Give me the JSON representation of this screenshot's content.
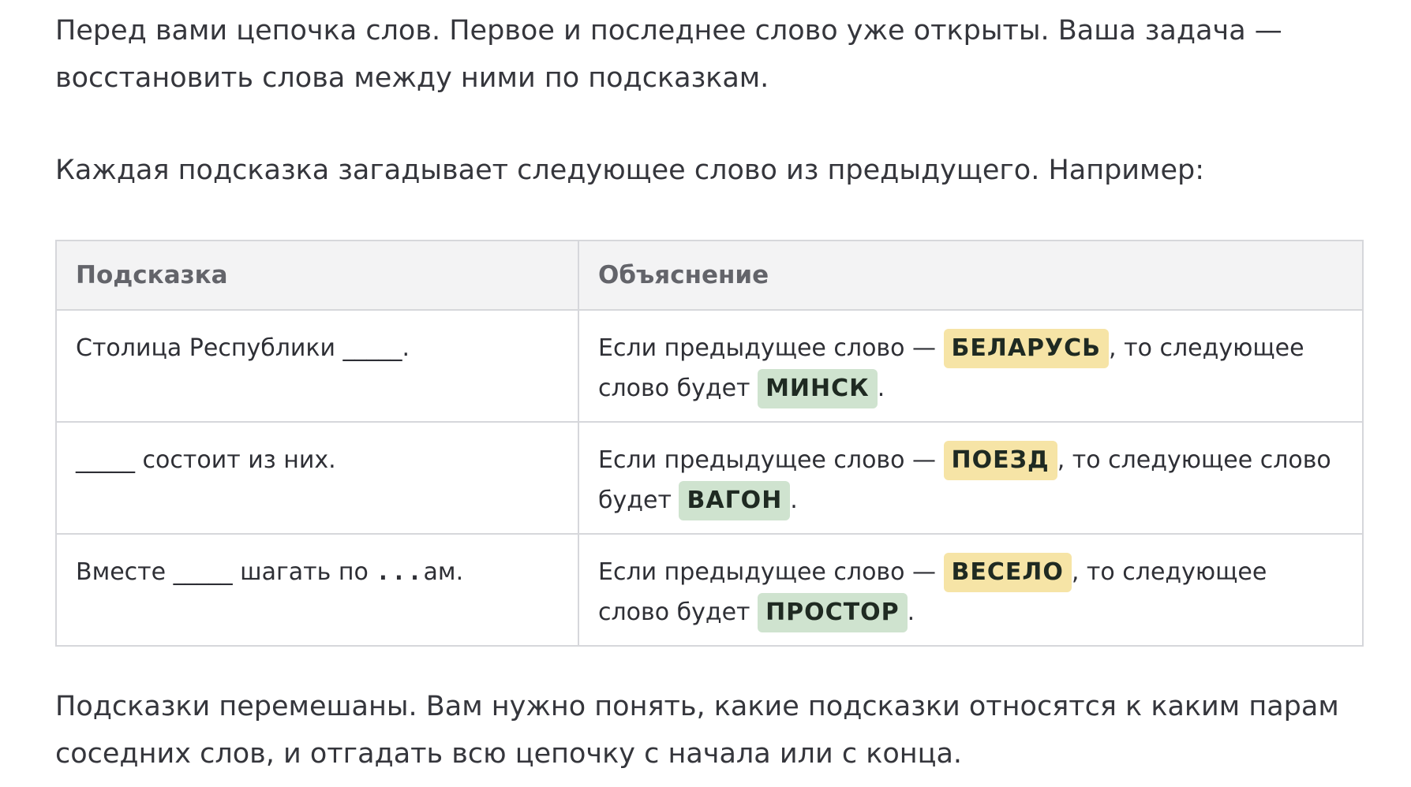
{
  "intro": "Перед вами цепочка слов. Первое и последнее слово уже открыты. Ваша задача — восстановить слова между ними по подсказкам.",
  "example_intro": "Каждая подсказка загадывает следующее слово из предыдущего. Например:",
  "table": {
    "headers": [
      "Подсказка",
      "Объяснение"
    ],
    "rows": [
      {
        "hint_before": "Столица Республики _____.",
        "hint_blank": "",
        "hint_dots": "",
        "hint_after": "",
        "expl_prefix": "Если предыдущее слово —",
        "prev_word": "БЕЛАРУСЬ",
        "expl_middle": ", то следующее слово будет",
        "next_word": "МИНСК",
        "expl_end": "."
      },
      {
        "hint_before": "_____ состоит из них.",
        "hint_blank": "",
        "hint_dots": "",
        "hint_after": "",
        "expl_prefix": "Если предыдущее слово —",
        "prev_word": "ПОЕЗД",
        "expl_middle": ", то следующее слово будет",
        "next_word": "ВАГОН",
        "expl_end": "."
      },
      {
        "hint_before": "Вместе _____ шагать по ",
        "hint_blank": "",
        "hint_dots": "...",
        "hint_after": "ам.",
        "expl_prefix": "Если предыдущее слово —",
        "prev_word": "ВЕСЕЛО",
        "expl_middle": ", то следующее слово будет",
        "next_word": "ПРОСТОР",
        "expl_end": "."
      }
    ]
  },
  "outro": "Подсказки перемешаны. Вам нужно понять, какие подсказки относятся к каким парам соседних слов, и отгадать всю цепочку с начала или с конца.",
  "colors": {
    "prev_word_bg": "#f6e4a6",
    "next_word_bg": "#cfe3cf",
    "header_bg": "#f3f3f4",
    "border": "#d6d7db"
  }
}
